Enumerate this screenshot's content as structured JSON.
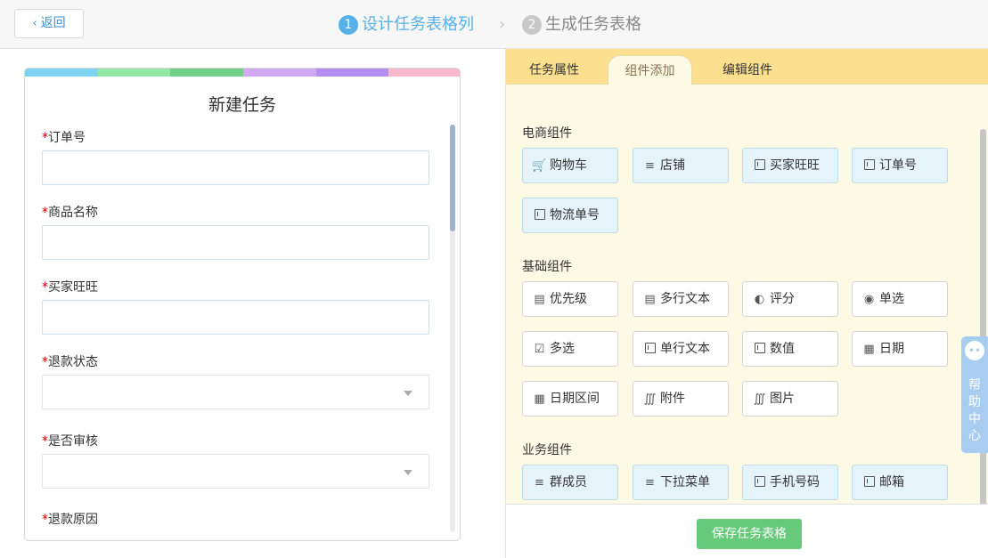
{
  "topbar": {
    "back_label": "返回",
    "steps": [
      {
        "num": "1",
        "label": "设计任务表格列"
      },
      {
        "num": "2",
        "label": "生成任务表格"
      }
    ],
    "separator": "›"
  },
  "form": {
    "title": "新建任务",
    "color_bar": [
      "#7dd3f0",
      "#93e6a6",
      "#73d187",
      "#cfa9f2",
      "#b48ef0",
      "#f8b9cf"
    ],
    "required_mark": "*",
    "fields": [
      {
        "label": "订单号",
        "type": "input"
      },
      {
        "label": "商品名称",
        "type": "input"
      },
      {
        "label": "买家旺旺",
        "type": "input"
      },
      {
        "label": "退款状态",
        "type": "select"
      },
      {
        "label": "是否审核",
        "type": "select"
      },
      {
        "label": "退款原因",
        "type": "input"
      }
    ]
  },
  "tabs": [
    {
      "label": "任务属性"
    },
    {
      "label": "组件添加",
      "active": true
    },
    {
      "label": "编辑组件"
    }
  ],
  "sections": {
    "ecommerce": {
      "title": "电商组件",
      "items": [
        {
          "label": "购物车",
          "icon": "cart-icon"
        },
        {
          "label": "店铺",
          "icon": "list-icon"
        },
        {
          "label": "买家旺旺",
          "icon": "field-icon"
        },
        {
          "label": "订单号",
          "icon": "field-icon"
        },
        {
          "label": "物流单号",
          "icon": "field-icon"
        }
      ]
    },
    "basic": {
      "title": "基础组件",
      "items": [
        {
          "label": "优先级",
          "icon": "doc-icon"
        },
        {
          "label": "多行文本",
          "icon": "doc-icon"
        },
        {
          "label": "评分",
          "icon": "pie-icon"
        },
        {
          "label": "单选",
          "icon": "radio-icon"
        },
        {
          "label": "多选",
          "icon": "checkbox-icon"
        },
        {
          "label": "单行文本",
          "icon": "field-icon"
        },
        {
          "label": "数值",
          "icon": "field-icon"
        },
        {
          "label": "日期",
          "icon": "calendar-icon"
        },
        {
          "label": "日期区间",
          "icon": "calendar-icon"
        },
        {
          "label": "附件",
          "icon": "paperclip-icon"
        },
        {
          "label": "图片",
          "icon": "paperclip-icon"
        }
      ]
    },
    "business": {
      "title": "业务组件",
      "items": [
        {
          "label": "群成员",
          "icon": "list-icon"
        },
        {
          "label": "下拉菜单",
          "icon": "list-icon"
        },
        {
          "label": "手机号码",
          "icon": "field-icon"
        },
        {
          "label": "邮箱",
          "icon": "field-icon"
        }
      ]
    }
  },
  "footer": {
    "save_label": "保存任务表格"
  },
  "help": {
    "label": "帮\n助\n中\n心"
  },
  "colors": {
    "accent": "#56b1ea",
    "save": "#67c97a",
    "tabbar": "#fde08f",
    "content_bg": "#fcf9e4"
  }
}
